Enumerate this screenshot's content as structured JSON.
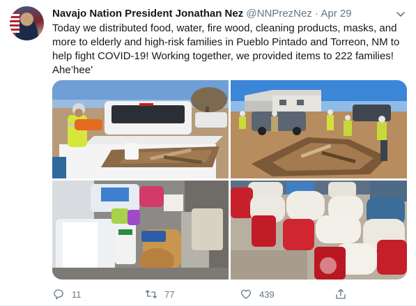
{
  "tweet": {
    "author_name": "Navajo Nation President Jonathan Nez",
    "handle": "@NNPrezNez",
    "separator": "·",
    "date": "Apr 29",
    "text": "Today we distributed food, water, fire wood, cleaning products, masks, and more to elderly and high-risk families in Pueblo Pintado and Torreon, NM to help fight COVID-19! Working together, we provided items to 222 families! Ahe’hee’",
    "media_count": 4
  },
  "actions": {
    "reply_count": "11",
    "retweet_count": "77",
    "like_count": "439"
  },
  "icons": {
    "avatar": "profile-avatar",
    "caret": "chevron-down-icon",
    "reply": "reply-icon",
    "retweet": "retweet-icon",
    "like": "heart-icon",
    "share": "share-icon"
  },
  "colors": {
    "text_primary": "#14171a",
    "text_secondary": "#657786",
    "divider": "#e6ecf0"
  }
}
